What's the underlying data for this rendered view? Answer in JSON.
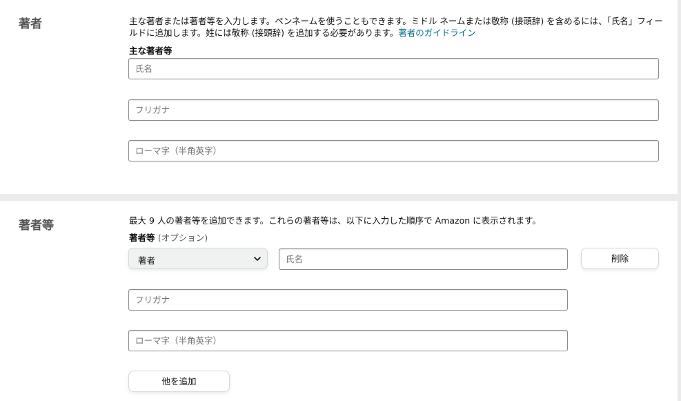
{
  "author_section": {
    "title": "著者",
    "description_text": "主な著者または著者等を入力します。ペンネームを使うこともできます。ミドル ネームまたは敬称 (接頭辞) を含めるには、「氏名」フィールドに追加します。姓には敬称 (接頭辞) を追加する必要があります。",
    "guideline_link": "著者のガイドライン",
    "field_label": "主な著者等",
    "name_placeholder": "氏名",
    "furigana_placeholder": "フリガナ",
    "romaji_placeholder": "ローマ字（半角英字）"
  },
  "contributors_section": {
    "title": "著者等",
    "description": "最大 9 人の著者等を追加できます。これらの著者等は、以下に入力した順序で Amazon に表示されます。",
    "field_label": "著者等",
    "field_optional": "(オプション)",
    "role_select_value": "著者",
    "name_placeholder": "氏名",
    "furigana_placeholder": "フリガナ",
    "romaji_placeholder": "ローマ字（半角英字）",
    "delete_button": "削除",
    "add_another_button": "他を追加"
  },
  "colors": {
    "page_background": "#ebebeb",
    "panel_background": "#ffffff",
    "link": "#007185",
    "section_title": "#555555",
    "input_border": "#888c8c"
  }
}
